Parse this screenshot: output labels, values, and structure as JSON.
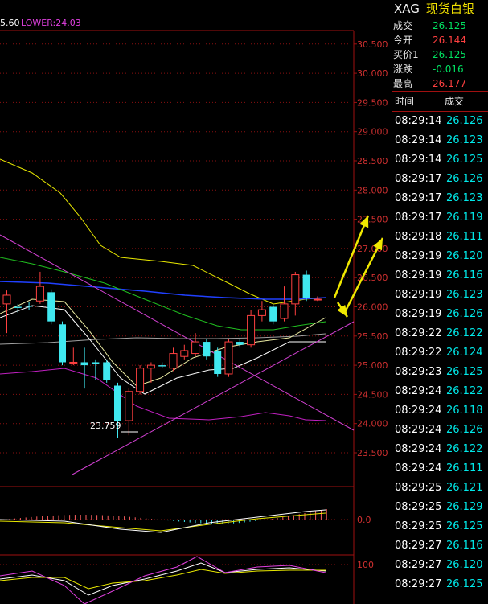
{
  "indicator": {
    "bb_label": "5.60",
    "lower_label": "LOWER:24.03"
  },
  "quote": {
    "code": "XAG",
    "name": "现货白银",
    "rows": [
      {
        "key": "成交",
        "value": "26.125",
        "color": "#00e060"
      },
      {
        "key": "今开",
        "value": "26.144",
        "color": "#ff4040"
      },
      {
        "key": "买价1",
        "value": "26.125",
        "color": "#00e060"
      },
      {
        "key": "涨跌",
        "value": "-0.016",
        "color": "#00e060"
      },
      {
        "key": "最高",
        "value": "26.177",
        "color": "#ff4040"
      }
    ]
  },
  "ticks": {
    "header_time": "时间",
    "header_deal": "成交",
    "rows": [
      {
        "time": "08:29:14",
        "price": "26.126"
      },
      {
        "time": "08:29:14",
        "price": "26.123"
      },
      {
        "time": "08:29:14",
        "price": "26.125"
      },
      {
        "time": "08:29:17",
        "price": "26.126"
      },
      {
        "time": "08:29:17",
        "price": "26.123"
      },
      {
        "time": "08:29:17",
        "price": "26.119"
      },
      {
        "time": "08:29:18",
        "price": "26.111"
      },
      {
        "time": "08:29:19",
        "price": "26.120"
      },
      {
        "time": "08:29:19",
        "price": "26.116"
      },
      {
        "time": "08:29:19",
        "price": "26.123"
      },
      {
        "time": "08:29:19",
        "price": "26.126"
      },
      {
        "time": "08:29:22",
        "price": "26.122"
      },
      {
        "time": "08:29:22",
        "price": "26.124"
      },
      {
        "time": "08:29:23",
        "price": "26.125"
      },
      {
        "time": "08:29:24",
        "price": "26.122"
      },
      {
        "time": "08:29:24",
        "price": "26.118"
      },
      {
        "time": "08:29:24",
        "price": "26.126"
      },
      {
        "time": "08:29:24",
        "price": "26.122"
      },
      {
        "time": "08:29:24",
        "price": "26.111"
      },
      {
        "time": "08:29:25",
        "price": "26.121"
      },
      {
        "time": "08:29:25",
        "price": "26.129"
      },
      {
        "time": "08:29:25",
        "price": "26.125"
      },
      {
        "time": "08:29:27",
        "price": "26.116"
      },
      {
        "time": "08:29:27",
        "price": "26.120"
      },
      {
        "time": "08:29:27",
        "price": "26.125"
      }
    ]
  },
  "chart_data": {
    "type": "candlestick",
    "price_axis": [
      "30.500",
      "30.000",
      "29.500",
      "29.000",
      "28.500",
      "28.000",
      "27.500",
      "27.000",
      "26.500",
      "26.000",
      "25.500",
      "25.000",
      "24.500",
      "24.000",
      "23.500"
    ],
    "ylim": [
      23.25,
      30.75
    ],
    "low_annotation": "23.759",
    "macd_axis": [
      "0.0"
    ],
    "kdj_axis": [
      "100"
    ],
    "candles": [
      {
        "o": 26.05,
        "c": 26.2,
        "h": 26.28,
        "l": 25.55
      },
      {
        "o": 26.0,
        "c": 25.98,
        "h": 26.05,
        "l": 25.9
      },
      {
        "o": 26.02,
        "c": 26.0,
        "h": 26.08,
        "l": 25.95
      },
      {
        "o": 26.1,
        "c": 26.35,
        "h": 26.6,
        "l": 26.05
      },
      {
        "o": 26.25,
        "c": 25.75,
        "h": 26.3,
        "l": 25.7
      },
      {
        "o": 25.7,
        "c": 25.05,
        "h": 25.75,
        "l": 25.0
      },
      {
        "o": 25.05,
        "c": 25.05,
        "h": 25.3,
        "l": 25.0
      },
      {
        "o": 25.05,
        "c": 25.0,
        "h": 25.3,
        "l": 24.6
      },
      {
        "o": 25.05,
        "c": 25.02,
        "h": 25.1,
        "l": 24.75
      },
      {
        "o": 25.05,
        "c": 24.75,
        "h": 25.1,
        "l": 24.7
      },
      {
        "o": 24.65,
        "c": 24.05,
        "h": 24.7,
        "l": 23.76
      },
      {
        "o": 24.05,
        "c": 24.55,
        "h": 24.6,
        "l": 23.8
      },
      {
        "o": 24.55,
        "c": 24.95,
        "h": 25.0,
        "l": 24.5
      },
      {
        "o": 24.95,
        "c": 25.0,
        "h": 25.05,
        "l": 24.7
      },
      {
        "o": 25.0,
        "c": 24.98,
        "h": 25.05,
        "l": 24.95
      },
      {
        "o": 24.95,
        "c": 25.2,
        "h": 25.3,
        "l": 24.9
      },
      {
        "o": 25.15,
        "c": 25.25,
        "h": 25.35,
        "l": 25.1
      },
      {
        "o": 25.2,
        "c": 25.4,
        "h": 25.55,
        "l": 25.15
      },
      {
        "o": 25.4,
        "c": 25.15,
        "h": 25.45,
        "l": 25.1
      },
      {
        "o": 25.25,
        "c": 24.85,
        "h": 25.3,
        "l": 24.8
      },
      {
        "o": 24.85,
        "c": 25.4,
        "h": 25.45,
        "l": 24.8
      },
      {
        "o": 25.4,
        "c": 25.35,
        "h": 25.45,
        "l": 25.3
      },
      {
        "o": 25.35,
        "c": 25.85,
        "h": 25.95,
        "l": 25.3
      },
      {
        "o": 25.85,
        "c": 25.95,
        "h": 26.1,
        "l": 25.75
      },
      {
        "o": 26.0,
        "c": 25.75,
        "h": 26.05,
        "l": 25.7
      },
      {
        "o": 25.8,
        "c": 26.05,
        "h": 26.35,
        "l": 25.75
      },
      {
        "o": 26.05,
        "c": 26.55,
        "h": 26.6,
        "l": 25.85
      },
      {
        "o": 26.55,
        "c": 26.15,
        "h": 26.62,
        "l": 26.1
      },
      {
        "o": 26.12,
        "c": 26.13,
        "h": 26.18,
        "l": 26.1
      }
    ]
  }
}
